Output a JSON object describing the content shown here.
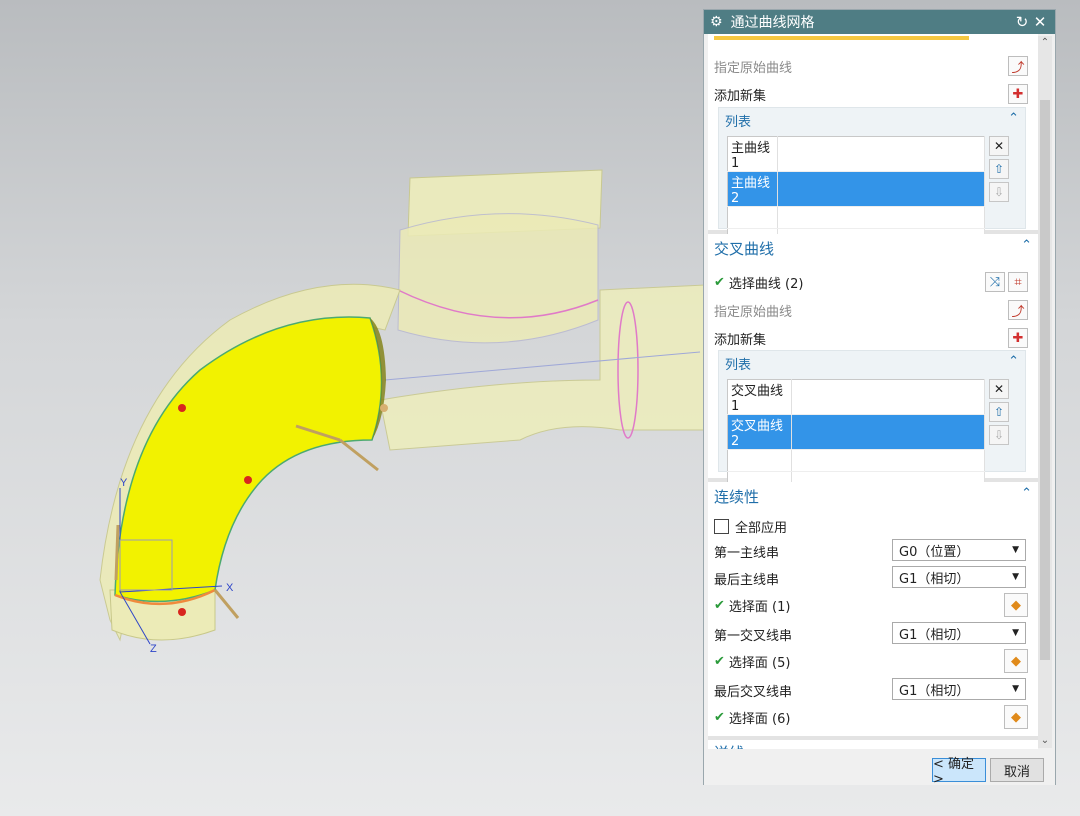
{
  "dialog": {
    "title": "通过曲线网格"
  },
  "primary": {
    "origin_label": "指定原始曲线",
    "add_set_label": "添加新集",
    "list_title": "列表",
    "items": [
      "主曲线 1",
      "主曲线 2"
    ]
  },
  "cross": {
    "title": "交叉曲线",
    "select_label": "选择曲线 (2)",
    "origin_label": "指定原始曲线",
    "add_set_label": "添加新集",
    "list_title": "列表",
    "items": [
      "交叉曲线 1",
      "交叉曲线 2"
    ]
  },
  "continuity": {
    "title": "连续性",
    "apply_all": "全部应用",
    "first_primary_label": "第一主线串",
    "first_primary_value": "G0（位置）",
    "last_primary_label": "最后主线串",
    "last_primary_value": "G1（相切）",
    "face1": "选择面 (1)",
    "first_cross_label": "第一交叉线串",
    "first_cross_value": "G1（相切）",
    "face5": "选择面 (5)",
    "last_cross_label": "最后交叉线串",
    "last_cross_value": "G1（相切）",
    "face6": "选择面 (6)"
  },
  "next_section": "送线",
  "footer": {
    "ok": "< 确定 >",
    "cancel": "取消"
  },
  "viewport": {
    "axis_x": "X",
    "axis_y": "Y",
    "axis_z": "Z"
  },
  "colors": {
    "titlebar": "#4f7d84",
    "accent": "#1f6ea9",
    "selection": "#3394e8",
    "surface": "#f2f200"
  }
}
